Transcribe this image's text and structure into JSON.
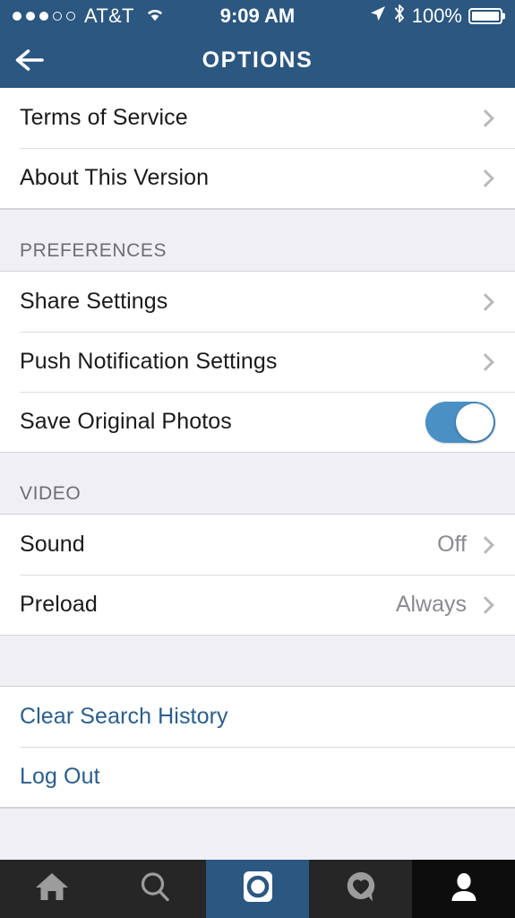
{
  "status_bar": {
    "signal_dots_filled": 3,
    "signal_dots_total": 5,
    "carrier": "AT&T",
    "wifi_icon": "wifi-icon",
    "time": "9:09 AM",
    "location_icon": "location-arrow-icon",
    "bluetooth_icon": "bluetooth-icon",
    "battery_percent": "100%",
    "battery_level": 100
  },
  "nav_bar": {
    "back_icon": "back-arrow-icon",
    "title": "OPTIONS",
    "background_color": "#2B5780"
  },
  "groups": [
    {
      "id": "about",
      "header": null,
      "rows": [
        {
          "label": "Terms of Service",
          "accessory": "chevron",
          "value": null
        },
        {
          "label": "About This Version",
          "accessory": "chevron",
          "value": null
        }
      ]
    },
    {
      "id": "preferences",
      "header": "PREFERENCES",
      "rows": [
        {
          "label": "Share Settings",
          "accessory": "chevron",
          "value": null
        },
        {
          "label": "Push Notification Settings",
          "accessory": "chevron",
          "value": null
        },
        {
          "label": "Save Original Photos",
          "accessory": "toggle",
          "value": null,
          "toggle_on": true
        }
      ]
    },
    {
      "id": "video",
      "header": "VIDEO",
      "rows": [
        {
          "label": "Sound",
          "accessory": "chevron",
          "value": "Off"
        },
        {
          "label": "Preload",
          "accessory": "chevron",
          "value": "Always"
        }
      ]
    },
    {
      "id": "actions",
      "header": null,
      "rows": [
        {
          "label": "Clear Search History",
          "accessory": "none",
          "value": null,
          "style": "link"
        },
        {
          "label": "Log Out",
          "accessory": "none",
          "value": null,
          "style": "link"
        }
      ]
    }
  ],
  "tab_bar": {
    "tabs": [
      {
        "id": "home",
        "icon": "home-icon",
        "state": "inactive"
      },
      {
        "id": "search",
        "icon": "search-icon",
        "state": "inactive"
      },
      {
        "id": "camera",
        "icon": "camera-icon",
        "state": "active"
      },
      {
        "id": "activity",
        "icon": "heart-bubble-icon",
        "state": "inactive"
      },
      {
        "id": "profile",
        "icon": "person-icon",
        "state": "selected"
      }
    ]
  },
  "colors": {
    "nav_blue": "#2B5780",
    "link_blue": "#2A5E8C",
    "toggle_on": "#4A90C4",
    "group_bg": "#EFEFF4",
    "row_bg": "#FFFFFF",
    "tabbar_bg": "#262626",
    "value_gray": "#8A8A8F"
  }
}
